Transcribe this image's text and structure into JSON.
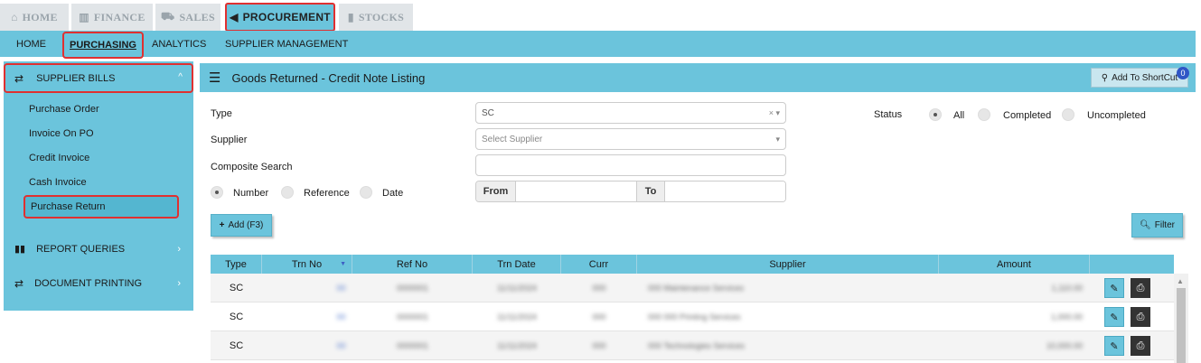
{
  "top_tabs": [
    {
      "label": "HOME",
      "icon": "home-icon",
      "glyph": "⌂"
    },
    {
      "label": "FINANCE",
      "icon": "bank-icon",
      "glyph": "🏛"
    },
    {
      "label": "SALES",
      "icon": "cart-icon",
      "glyph": "🛒"
    },
    {
      "label": "PROCUREMENT",
      "icon": "megaphone-icon",
      "glyph": "📢"
    },
    {
      "label": "STOCKS",
      "icon": "bar-chart-icon",
      "glyph": "📊"
    }
  ],
  "sub_nav": [
    "HOME",
    "PURCHASING",
    "ANALYTICS",
    "SUPPLIER MANAGEMENT"
  ],
  "sidebar": {
    "header": {
      "label": "SUPPLIER BILLS",
      "icon": "exchange-icon"
    },
    "items": [
      "Purchase Order",
      "Invoice On PO",
      "Credit Invoice",
      "Cash Invoice",
      "Purchase Return"
    ],
    "groups": [
      {
        "label": "REPORT QUERIES",
        "icon": "bar-chart-icon"
      },
      {
        "label": "DOCUMENT PRINTING",
        "icon": "exchange-icon"
      }
    ]
  },
  "panel": {
    "title": "Goods Returned - Credit Note Listing",
    "shortcut_label": "Add To ShortCut",
    "shortcut_badge": "0"
  },
  "filters": {
    "type_label": "Type",
    "type_value": "SC",
    "supplier_label": "Supplier",
    "supplier_placeholder": "Select Supplier",
    "composite_label": "Composite Search",
    "composite_value": "",
    "search_by": [
      "Number",
      "Reference",
      "Date"
    ],
    "from_label": "From",
    "to_label": "To",
    "status_label": "Status",
    "status_options": [
      "All",
      "Completed",
      "Uncompleted"
    ]
  },
  "actions": {
    "add_label": "Add (F3)",
    "filter_label": "Filter"
  },
  "table": {
    "columns": [
      "Type",
      "Trn No",
      "Ref No",
      "Trn Date",
      "Curr",
      "Supplier",
      "Amount"
    ],
    "rows": [
      {
        "type": "SC",
        "trn_no": "00",
        "ref_no": "0000001",
        "trn_date": "11/11/2024",
        "curr": "000",
        "supplier": "000 Maintenance Services",
        "amount": "1,110.00"
      },
      {
        "type": "SC",
        "trn_no": "00",
        "ref_no": "0000001",
        "trn_date": "11/11/2024",
        "curr": "000",
        "supplier": "000 000 Printing Services",
        "amount": "1,000.00"
      },
      {
        "type": "SC",
        "trn_no": "00",
        "ref_no": "0000001",
        "trn_date": "11/11/2024",
        "curr": "000",
        "supplier": "000 Technologies Services",
        "amount": "10,000.00"
      }
    ]
  }
}
